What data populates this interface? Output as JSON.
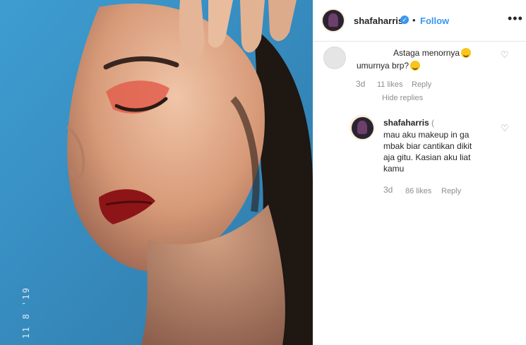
{
  "post": {
    "date_stamp": "11 8 '19"
  },
  "header": {
    "username": "shafaharris",
    "verified_icon": "✓",
    "separator": "•",
    "follow_label": "Follow",
    "more_label": "•••"
  },
  "comment": {
    "text_line1": "Astaga menornya",
    "text_line2": "umurnya brp?",
    "age": "3d",
    "likes": "11 likes",
    "reply_label": "Reply",
    "hide_replies_label": "Hide replies"
  },
  "reply": {
    "username": "shafaharris",
    "verified_mark": "(",
    "text": "mau aku makeup in ga mbak biar cantikan dikit aja gitu. Kasian aku liat kamu",
    "age": "3d",
    "likes": "86 likes",
    "reply_label": "Reply"
  },
  "icons": {
    "heart": "♡"
  },
  "colors": {
    "link_blue": "#3897f0",
    "muted_gray": "#8e8e8e",
    "background_blue": "#3b8fbf"
  }
}
